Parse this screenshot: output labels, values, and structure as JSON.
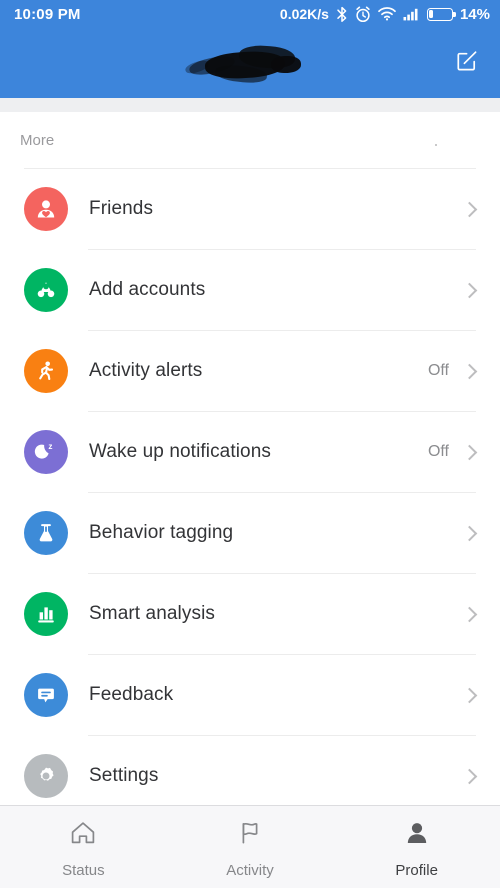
{
  "statusbar": {
    "time": "10:09 PM",
    "network_speed": "0.02K/s",
    "battery_percent": "14%",
    "icons": [
      "bluetooth-icon",
      "alarm-icon",
      "wifi-icon",
      "cellular-signal-icon",
      "battery-icon"
    ]
  },
  "appbar": {
    "title_redacted": "",
    "edit_icon": "edit-compose-icon",
    "background_color": "#3d85db"
  },
  "section": {
    "label": "More"
  },
  "rows": [
    {
      "label": "Friends",
      "value": "",
      "icon": "person-heart-icon",
      "color": "#f4645f"
    },
    {
      "label": "Add accounts",
      "value": "",
      "icon": "recycle-nodes-icon",
      "color": "#00b563"
    },
    {
      "label": "Activity alerts",
      "value": "Off",
      "icon": "running-person-icon",
      "color": "#f98012"
    },
    {
      "label": "Wake up notifications",
      "value": "Off",
      "icon": "moon-sleep-icon",
      "color": "#7c6fd4"
    },
    {
      "label": "Behavior tagging",
      "value": "",
      "icon": "flask-icon",
      "color": "#3d8bd8"
    },
    {
      "label": "Smart analysis",
      "value": "",
      "icon": "bar-chart-icon",
      "color": "#00b563"
    },
    {
      "label": "Feedback",
      "value": "",
      "icon": "speech-bubble-icon",
      "color": "#3d8bd8"
    },
    {
      "label": "Settings",
      "value": "",
      "icon": "gear-icon",
      "color": "#b7bbbe"
    }
  ],
  "tabbar": {
    "tabs": [
      {
        "label": "Status",
        "icon": "home-icon",
        "active": false
      },
      {
        "label": "Activity",
        "icon": "flag-icon",
        "active": false
      },
      {
        "label": "Profile",
        "icon": "person-icon",
        "active": true
      }
    ]
  }
}
